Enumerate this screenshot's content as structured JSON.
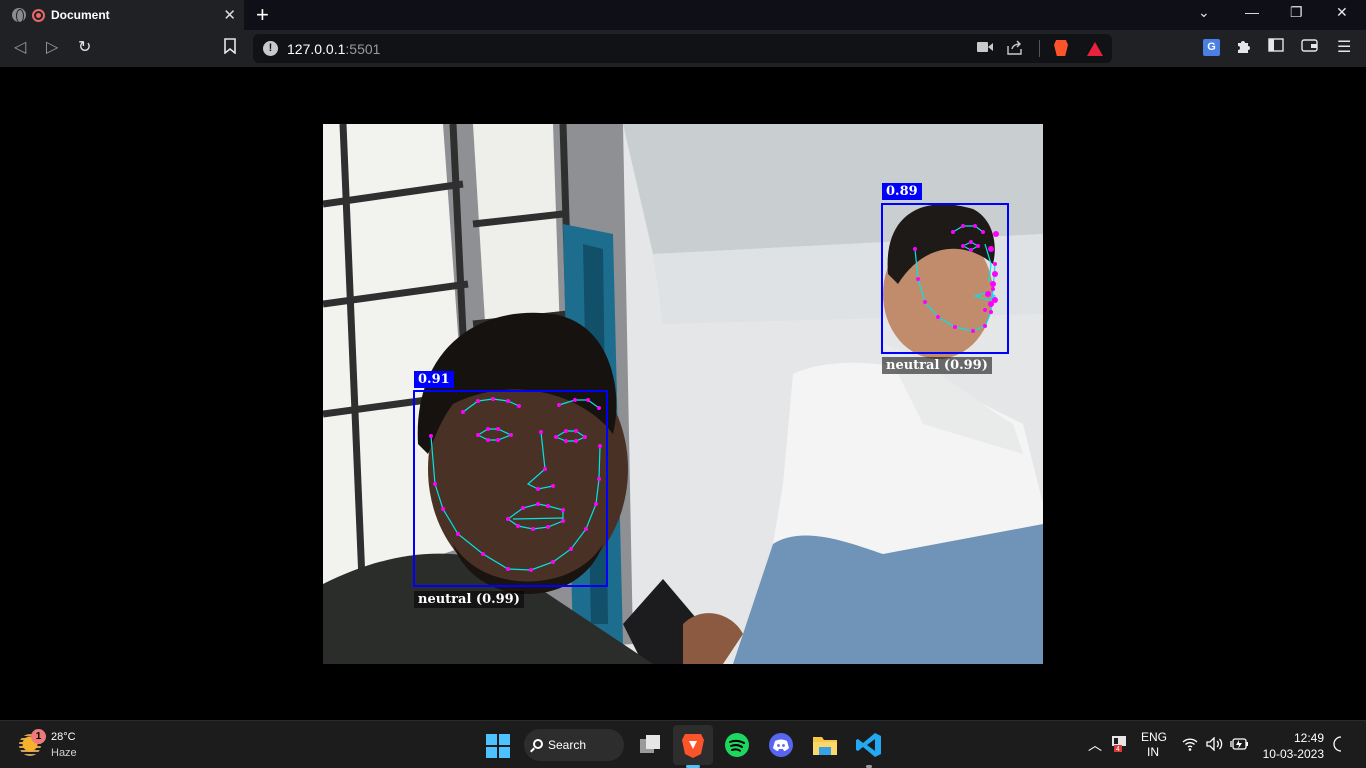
{
  "browser": {
    "tab_title": "Document",
    "tab_close": "✕",
    "new_tab": "+",
    "url_host": "127.0.0.1",
    "url_port": ":5501",
    "window_controls": {
      "chevron": "⌄",
      "minimize": "—",
      "restore": "❐",
      "close": "✕"
    }
  },
  "detections": [
    {
      "score": "0.91",
      "emotion": "neutral (0.99)"
    },
    {
      "score": "0.89",
      "emotion": "neutral (0.99)"
    }
  ],
  "taskbar": {
    "weather": {
      "badge": "1",
      "temp": "28°C",
      "desc": "Haze"
    },
    "search_label": "Search",
    "language": {
      "line1": "ENG",
      "line2": "IN"
    },
    "clock": {
      "time": "12:49",
      "date": "10-03-2023"
    },
    "colors": {
      "accent": "#4cc2ff",
      "spotify": "#1ed760",
      "discord": "#5865f2",
      "vscode": "#23a9f2",
      "folder": "#f7c948"
    }
  }
}
